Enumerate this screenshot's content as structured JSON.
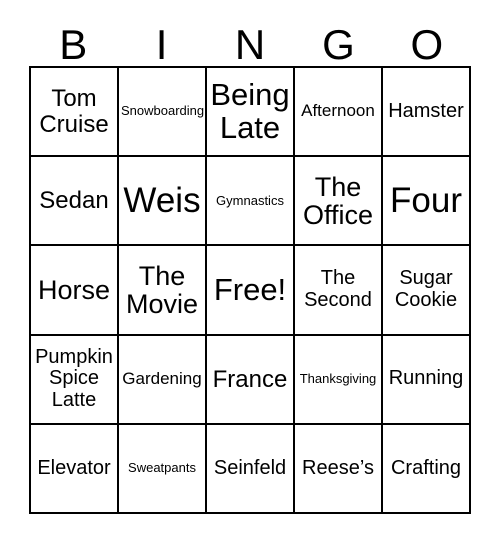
{
  "header": {
    "letters": [
      "B",
      "I",
      "N",
      "G",
      "O"
    ]
  },
  "grid": {
    "columns": 5,
    "rows": 5,
    "cells": [
      {
        "text": "Tom\nCruise",
        "size": "l"
      },
      {
        "text": "Snowboarding",
        "size": "xs"
      },
      {
        "text": "Being\nLate",
        "size": "xxl"
      },
      {
        "text": "Afternoon",
        "size": "s"
      },
      {
        "text": "Hamster",
        "size": "m"
      },
      {
        "text": "Sedan",
        "size": "l"
      },
      {
        "text": "Weis",
        "size": "max"
      },
      {
        "text": "Gymnastics",
        "size": "xs"
      },
      {
        "text": "The\nOffice",
        "size": "xl"
      },
      {
        "text": "Four",
        "size": "max"
      },
      {
        "text": "Horse",
        "size": "xl"
      },
      {
        "text": "The\nMovie",
        "size": "xl"
      },
      {
        "text": "Free!",
        "size": "xxl"
      },
      {
        "text": "The\nSecond",
        "size": "m"
      },
      {
        "text": "Sugar\nCookie",
        "size": "m"
      },
      {
        "text": "Pumpkin\nSpice\nLatte",
        "size": "m"
      },
      {
        "text": "Gardening",
        "size": "s"
      },
      {
        "text": "France",
        "size": "l"
      },
      {
        "text": "Thanksgiving",
        "size": "xs"
      },
      {
        "text": "Running",
        "size": "m"
      },
      {
        "text": "Elevator",
        "size": "m"
      },
      {
        "text": "Sweatpants",
        "size": "xs"
      },
      {
        "text": "Seinfeld",
        "size": "m"
      },
      {
        "text": "Reese’s",
        "size": "m"
      },
      {
        "text": "Crafting",
        "size": "m"
      }
    ]
  },
  "colors": {
    "border": "#000000",
    "background": "#ffffff",
    "text": "#000000"
  }
}
